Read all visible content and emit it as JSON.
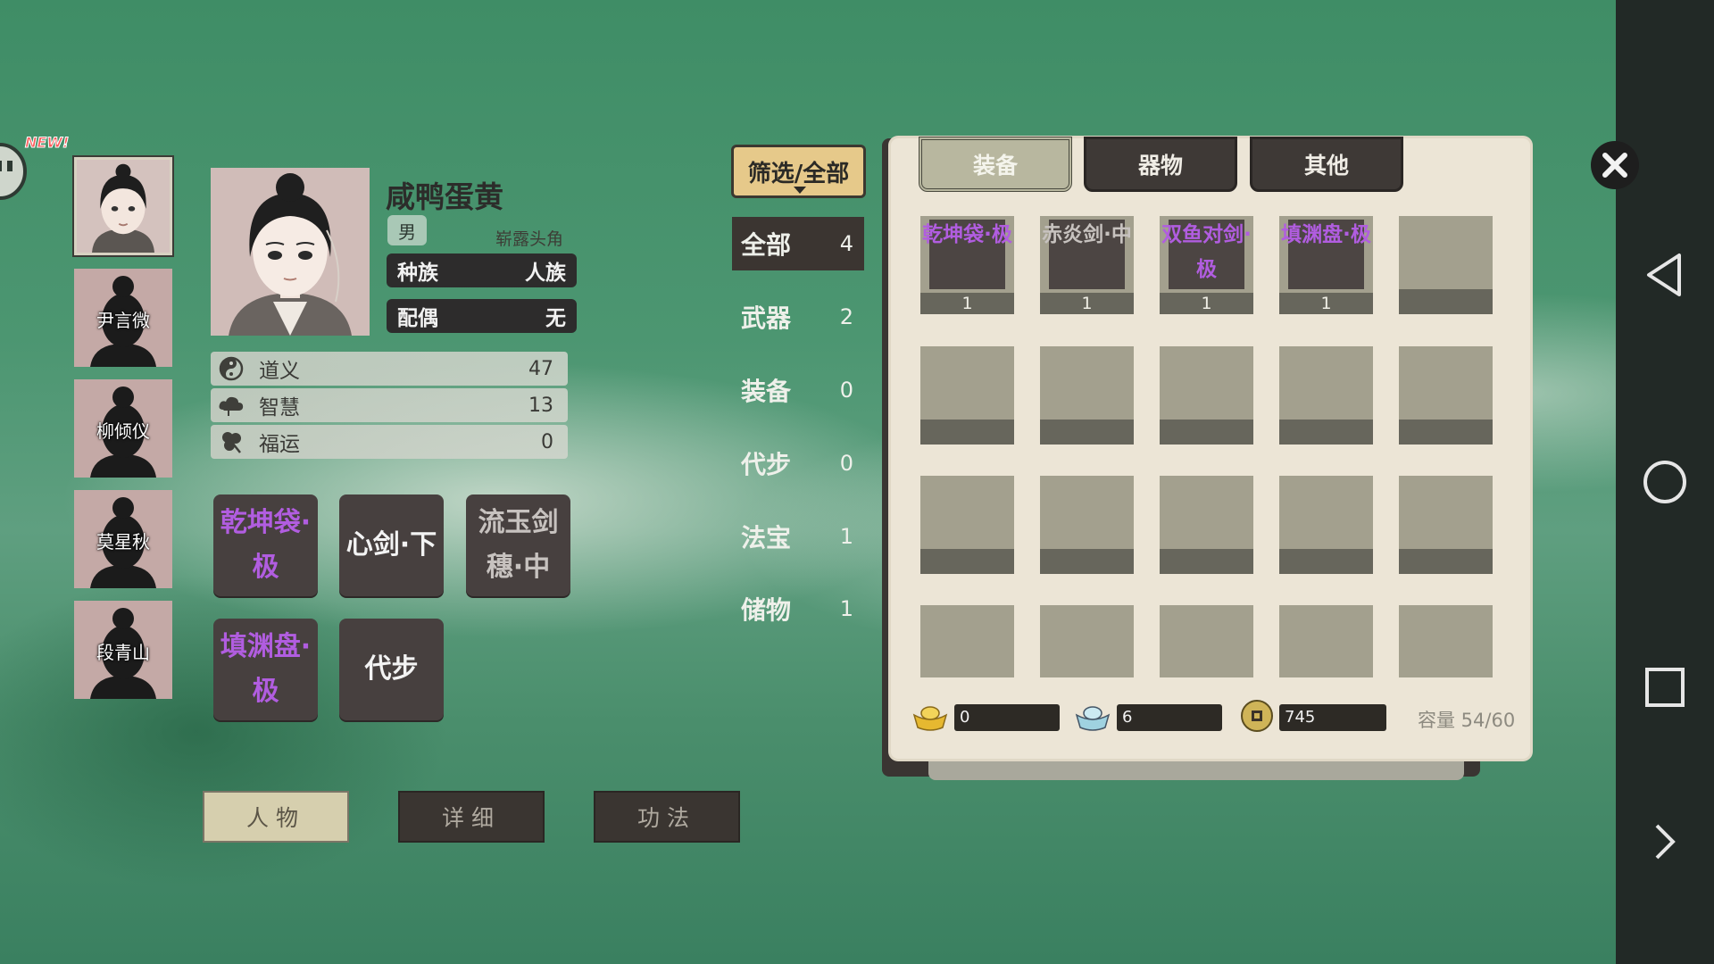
{
  "colors": {
    "accent_purple": "#b15de0",
    "muted_text": "#c7c2bf",
    "panel_bg": "#ece5d6",
    "active_tab": "#d6cfae",
    "filter_btn": "#e6c98a"
  },
  "new_badge": "NEW!",
  "characters": [
    {
      "name": "",
      "active": true
    },
    {
      "name": "尹言微"
    },
    {
      "name": "柳倾仪"
    },
    {
      "name": "莫星秋"
    },
    {
      "name": "段青山"
    }
  ],
  "profile": {
    "name": "咸鸭蛋黄",
    "gender": "男",
    "status": "崭露头角",
    "race_label": "种族",
    "race_value": "人族",
    "spouse_label": "配偶",
    "spouse_value": "无",
    "stats": [
      {
        "icon": "yin-yang-icon",
        "label": "道义",
        "value": "47"
      },
      {
        "icon": "cloud-icon",
        "label": "智慧",
        "value": "13"
      },
      {
        "icon": "clover-icon",
        "label": "福运",
        "value": "0"
      }
    ]
  },
  "equipped": [
    {
      "name": "乾坤袋·极",
      "tier": "purple"
    },
    {
      "name": "心剑·下",
      "tier": "white"
    },
    {
      "name": "流玉剑穗·中",
      "tier": "muted"
    },
    {
      "name": "填渊盘·极",
      "tier": "purple"
    },
    {
      "name": "代步",
      "tier": "white"
    }
  ],
  "bottom_tabs": [
    {
      "label": "人物",
      "active": true
    },
    {
      "label": "详细",
      "active": false
    },
    {
      "label": "功法",
      "active": false
    }
  ],
  "filter": {
    "label": "筛选/全部",
    "categories": [
      {
        "label": "全部",
        "count": "4",
        "active": true
      },
      {
        "label": "武器",
        "count": "2"
      },
      {
        "label": "装备",
        "count": "0"
      },
      {
        "label": "代步",
        "count": "0"
      },
      {
        "label": "法宝",
        "count": "1"
      },
      {
        "label": "储物",
        "count": "1"
      }
    ]
  },
  "inventory": {
    "tabs": [
      {
        "label": "装备",
        "active": true
      },
      {
        "label": "器物",
        "active": false
      },
      {
        "label": "其他",
        "active": false
      }
    ],
    "items": [
      {
        "name": "乾坤袋·极",
        "count": "1",
        "tier": "purple"
      },
      {
        "name": "赤炎剑·中",
        "count": "1",
        "tier": "muted"
      },
      {
        "name": "双鱼对剑·极",
        "count": "1",
        "tier": "purple"
      },
      {
        "name": "填渊盘·极",
        "count": "1",
        "tier": "purple"
      }
    ],
    "currency": [
      {
        "icon": "gold-ingot-icon",
        "value": "0"
      },
      {
        "icon": "silver-ingot-icon",
        "value": "6"
      },
      {
        "icon": "coin-icon",
        "value": "745"
      }
    ],
    "capacity": "容量 54/60"
  }
}
